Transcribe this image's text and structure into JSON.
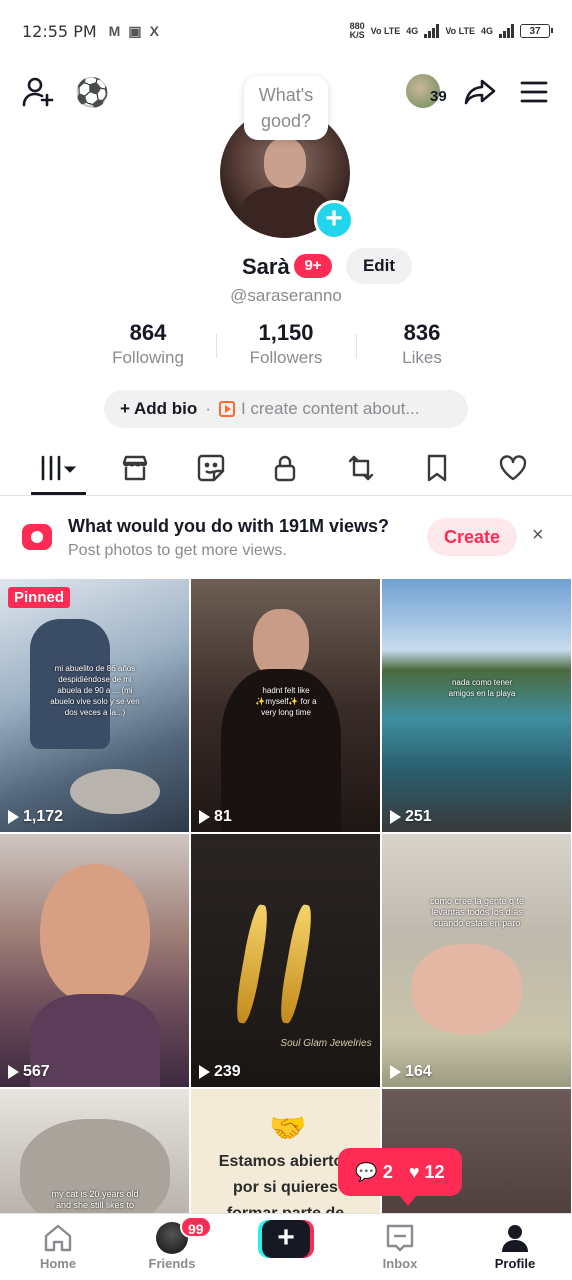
{
  "status_bar": {
    "time": "12:55 PM",
    "notifications": [
      "M",
      "▣",
      "X"
    ],
    "speed_value": "880",
    "speed_unit": "K/S",
    "carrier1": "Vo LTE",
    "net1": "4G",
    "carrier2": "Vo LTE",
    "net2": "4G",
    "battery": "37"
  },
  "top_bar": {
    "visitor_count": "39"
  },
  "profile": {
    "prompt_bubble": "What's good?",
    "name": "Sarà",
    "notif_badge": "9+",
    "edit_label": "Edit",
    "handle": "@saraseranno"
  },
  "stats": [
    {
      "num": "864",
      "label": "Following"
    },
    {
      "num": "1,150",
      "label": "Followers"
    },
    {
      "num": "836",
      "label": "Likes"
    }
  ],
  "bio": {
    "add_label": "+ Add bio",
    "separator": "·",
    "placeholder": "I create content about..."
  },
  "tabs": [
    "videos",
    "shop",
    "stickers",
    "private",
    "reposts",
    "saved",
    "liked"
  ],
  "promo": {
    "title": "What would you do with 191M views?",
    "subtitle": "Post photos to get more views.",
    "create_label": "Create",
    "close_label": "×"
  },
  "grid": [
    {
      "views": "1,172",
      "pinned": "Pinned",
      "caption": "mi abuelito de 86 años despidiéndose de mi abuela de 90 a ... (mi abuelo vive solo y se ven dos veces a la...)",
      "bg": "#8aa0b4"
    },
    {
      "views": "81",
      "caption": "hadnt felt like ✨myself✨ for a very long time",
      "bg": "#3a2c28"
    },
    {
      "views": "251",
      "caption": "nada como tener amigos en la playa",
      "bg": "#5f8fb0"
    },
    {
      "views": "567",
      "bg": "#7a5a62"
    },
    {
      "views": "239",
      "caption": "Soul Glam Jewelries",
      "bg": "#1a1614"
    },
    {
      "views": "164",
      "caption": "como cree la gente q te levantas todos los días cuando estás en paro",
      "bg": "#bfb8ad"
    },
    {
      "caption": "my cat is 20 years old and she still likes to",
      "bg": "#b8b2ab"
    },
    {
      "caption": "Estamos abiertos por si quieres formar parte de",
      "bg": "#f3ead8"
    },
    {
      "bg": "#5a4a48"
    }
  ],
  "likes_popup": {
    "comments": "2",
    "likes": "12"
  },
  "bottom_nav": {
    "home": "Home",
    "friends": "Friends",
    "friends_badge": "99",
    "inbox": "Inbox",
    "profile": "Profile"
  }
}
